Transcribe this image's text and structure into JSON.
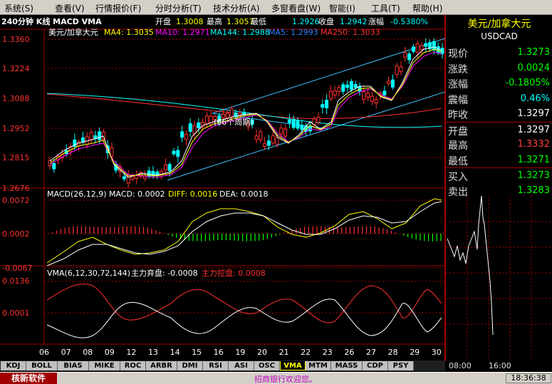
{
  "menu": {
    "items": [
      "系统(S)",
      "查看(V)",
      "行情报价(F)",
      "分时分析(T)",
      "技术分析(A)",
      "多窗看盘(W)",
      "智能(I)",
      "工具(T)",
      "帮助(H)"
    ]
  },
  "chart_header": {
    "timeframe": "240分钟 K线 MACD VMA",
    "open_label": "开盘",
    "open_value": "1.3008",
    "high_label": "最高",
    "high_value": "1.3057",
    "low_label": "最低",
    "low_value": "1.2926",
    "close_label": "收盘",
    "close_value": "1.2942",
    "change_label": "涨幅",
    "change_value": "-0.5380%"
  },
  "main_panel": {
    "symbol": "美元/加拿大元",
    "ma4": "MA4: 1.3035",
    "ma10": "MA10: 1.2971",
    "ma144": "MA144: 1.2988",
    "ma5": "MA5: 1.2993",
    "ma250": "MA250: 1.3033",
    "annotation": "(66个周期)",
    "y_ticks": [
      "1.3360",
      "1.3224",
      "1.3088",
      "1.2952",
      "1.2815",
      "1.2676"
    ]
  },
  "macd_panel": {
    "title": "MACD(26,12,9)",
    "macd": "MACD: 0.0002",
    "diff": "DIFF: 0.0016",
    "dea": "DEA: 0.0018",
    "y_ticks": [
      "0.0072",
      "0.0002",
      "-0.0067"
    ]
  },
  "vma_panel": {
    "title": "VMA(6,12,30,72,144)",
    "sell_text": "主力弃盘: -0.0008",
    "control_text": "主力控盘: 0.0008",
    "y_ticks": [
      "0.0136",
      "0.0001"
    ]
  },
  "x_axis": {
    "labels": [
      "06",
      "07",
      "08",
      "09",
      "12",
      "13",
      "14",
      "15",
      "16",
      "19",
      "20",
      "21",
      "22",
      "23",
      "26",
      "27",
      "28",
      "29",
      "30"
    ]
  },
  "quote_panel": {
    "symbol_cn": "美元/加拿大元",
    "symbol_en": "USDCAD",
    "rows": [
      {
        "label": "现价",
        "value": "1.3273",
        "color": "#00ff00"
      },
      {
        "label": "涨跌",
        "value": "0.0024",
        "color": "#00ff00"
      },
      {
        "label": "涨幅",
        "value": "-0.1805%",
        "color": "#00ff00"
      },
      {
        "label": "震幅",
        "value": "0.46%",
        "color": "#00ffff"
      },
      {
        "label": "昨收",
        "value": "1.3297",
        "color": "#ffffff"
      },
      {
        "label": "开盘",
        "value": "1.3297",
        "color": "#ffffff"
      },
      {
        "label": "最高",
        "value": "1.3332",
        "color": "#ff4040"
      },
      {
        "label": "最低",
        "value": "1.3271",
        "color": "#00ff00"
      },
      {
        "label": "买入",
        "value": "1.3273",
        "color": "#00ff00"
      },
      {
        "label": "卖出",
        "value": "1.3283",
        "color": "#00ff00"
      }
    ],
    "time_start": "08:00",
    "time_mid": "16:00"
  },
  "tabs": [
    "KDJ",
    "BOLL",
    "BIAS",
    "MIKE",
    "ROC",
    "ARBR",
    "DMI",
    "RSI",
    "ASI",
    "OSC",
    "VMA",
    "MTM",
    "MASS",
    "CDP",
    "PSY"
  ],
  "active_tab": "VMA",
  "status": {
    "logo": "核新软件",
    "ticker": "招商银行欢迎您。",
    "time": "18:36:38"
  },
  "colors": {
    "up": "#ff3030",
    "down": "#00ffff",
    "ma4": "#ffffff",
    "ma10": "#ff00ff",
    "ma144": "#00ffff",
    "ma250": "#ff0000",
    "grid": "#a00000",
    "macd_bar_up": "#ff3030",
    "macd_bar_down": "#00ff00"
  }
}
